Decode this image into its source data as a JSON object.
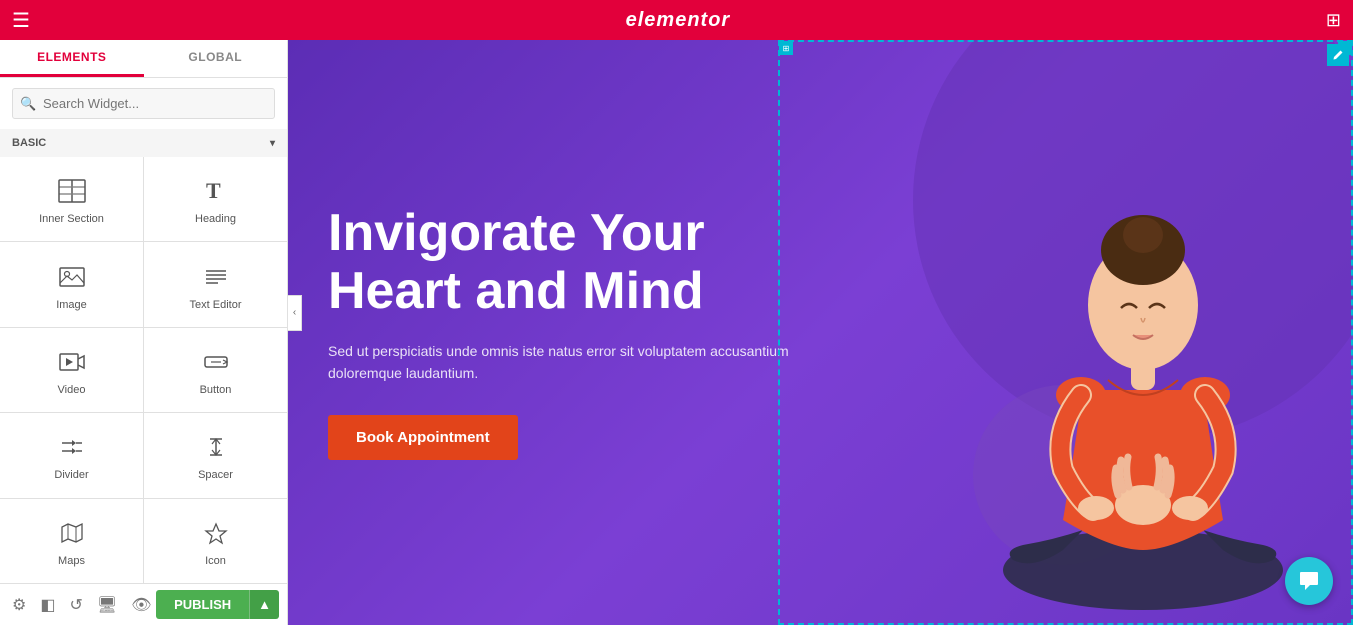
{
  "topbar": {
    "logo": "elementor",
    "hamburger_label": "☰",
    "grid_label": "⊞"
  },
  "sidebar": {
    "tabs": [
      {
        "id": "elements",
        "label": "ELEMENTS",
        "active": true
      },
      {
        "id": "global",
        "label": "GLOBAL",
        "active": false
      }
    ],
    "search_placeholder": "Search Widget...",
    "section_label": "BASIC",
    "widgets": [
      {
        "id": "inner-section",
        "label": "Inner Section",
        "icon": "inner-section-icon"
      },
      {
        "id": "heading",
        "label": "Heading",
        "icon": "heading-icon"
      },
      {
        "id": "image",
        "label": "Image",
        "icon": "image-icon"
      },
      {
        "id": "text-editor",
        "label": "Text Editor",
        "icon": "text-editor-icon"
      },
      {
        "id": "video",
        "label": "Video",
        "icon": "video-icon"
      },
      {
        "id": "button",
        "label": "Button",
        "icon": "button-icon"
      },
      {
        "id": "divider",
        "label": "Divider",
        "icon": "divider-icon"
      },
      {
        "id": "spacer",
        "label": "Spacer",
        "icon": "spacer-icon"
      },
      {
        "id": "maps",
        "label": "Maps",
        "icon": "maps-icon"
      },
      {
        "id": "icon",
        "label": "Icon",
        "icon": "icon-widget-icon"
      }
    ]
  },
  "bottom_toolbar": {
    "icons": [
      "settings",
      "layers",
      "history",
      "responsive",
      "preview"
    ],
    "publish_label": "PUBLISH",
    "publish_arrow": "▲"
  },
  "canvas": {
    "heading_line1": "Invigorate Your",
    "heading_line2": "Heart and Mind",
    "subtext": "Sed ut perspiciatis unde omnis iste natus error sit voluptatem accusantium doloremque laudantium.",
    "cta_label": "Book Appointment"
  }
}
